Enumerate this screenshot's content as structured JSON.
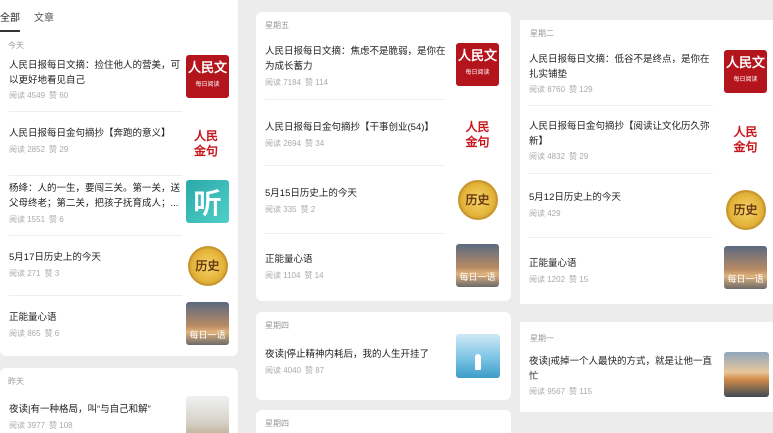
{
  "tabs": [
    "全部",
    "文章"
  ],
  "col1": {
    "day1": "今天",
    "items1": [
      {
        "title": "人民日报每日文摘：捡住他人的营美，可以更好地看见自己",
        "read": "阅读 4549",
        "like": "赞 60",
        "thumb": "rmwz"
      },
      {
        "title": "人民日报每日金句摘抄【奔跑的意义】",
        "read": "阅读 2852",
        "like": "赞 29",
        "thumb": "rmjj"
      },
      {
        "title": "杨绛：人的一生，要闯三关。第一关，送父母终老；第二关，把孩子抚育成人；...",
        "read": "阅读 1551",
        "like": "赞 6",
        "thumb": "ting"
      },
      {
        "title": "5月17日历史上的今天",
        "read": "阅读 271",
        "like": "赞 3",
        "thumb": "lishi"
      },
      {
        "title": "正能量心语",
        "read": "阅读 865",
        "like": "赞 6",
        "thumb": "meiri"
      }
    ],
    "day2": "昨天",
    "items2": [
      {
        "title": "夜读|有一种格局，叫“与自己和解”",
        "read": "阅读 3977",
        "like": "赞 108",
        "thumb": "sand"
      }
    ]
  },
  "col2": {
    "day1": "星期五",
    "items1": [
      {
        "title": "人民日报每日文摘：焦虑不是脆弱，是你在为成长蓄力",
        "read": "阅读 7184",
        "like": "赞 114",
        "thumb": "rmwz"
      },
      {
        "title": "人民日报每日金句摘抄【干事创业(54)】",
        "read": "阅读 2694",
        "like": "赞 34",
        "thumb": "rmjj"
      },
      {
        "title": "5月15日历史上的今天",
        "read": "阅读 335",
        "like": "赞 2",
        "thumb": "lishi"
      },
      {
        "title": "正能量心语",
        "read": "阅读 1104",
        "like": "赞 14",
        "thumb": "meiri"
      }
    ],
    "day2": "星期四",
    "items2": [
      {
        "title": "夜读|停止精神内耗后，我的人生开挂了",
        "read": "阅读 4040",
        "like": "赞 87",
        "thumb": "sea"
      }
    ],
    "day3": "星期四"
  },
  "col3": {
    "day1": "星期二",
    "items1": [
      {
        "title": "人民日报每日文摘：低谷不是终点，是你在扎实铺垫",
        "read": "阅读 8760",
        "like": "赞 129",
        "thumb": "rmwz"
      },
      {
        "title": "人民日报每日金句摘抄【阅读让文化历久弥新】",
        "read": "阅读 4832",
        "like": "赞 29",
        "thumb": "rmjj"
      },
      {
        "title": "5月12日历史上的今天",
        "read": "阅读 429",
        "like": "",
        "thumb": "lishi"
      },
      {
        "title": "正能量心语",
        "read": "阅读 1202",
        "like": "赞 15",
        "thumb": "meiri"
      }
    ],
    "day2": "星期一",
    "items2": [
      {
        "title": "夜读|戒掉一个人最快的方式，就是让他一直忙",
        "read": "阅读 9567",
        "like": "赞 115",
        "thumb": "sunset"
      }
    ]
  },
  "thumb_text": {
    "rmwz_main": "人民文",
    "rmwz_sub": "每日阅读",
    "rmjj": "人民金句",
    "ting": "听",
    "lishi": "历史",
    "meiri": "每日一语"
  },
  "colors": {
    "brand_red": "#b4151d",
    "gold": "#e4b43a",
    "bg": "#ececec"
  }
}
